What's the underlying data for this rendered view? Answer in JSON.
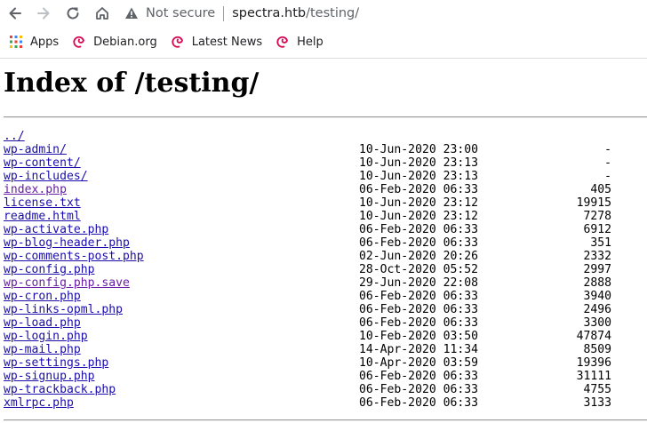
{
  "browser": {
    "address": {
      "security_label": "Not secure",
      "host": "spectra.htb",
      "path": "/testing/"
    },
    "bookmarks": [
      {
        "label": "Apps",
        "icon": "apps-grid-icon"
      },
      {
        "label": "Debian.org",
        "icon": "debian-swirl-icon"
      },
      {
        "label": "Latest News",
        "icon": "debian-swirl-icon"
      },
      {
        "label": "Help",
        "icon": "debian-swirl-icon"
      }
    ]
  },
  "page": {
    "title": "Index of /testing/",
    "entries": [
      {
        "name": "../",
        "date": "",
        "size": "",
        "visited": false
      },
      {
        "name": "wp-admin/",
        "date": "10-Jun-2020 23:00",
        "size": "-",
        "visited": false
      },
      {
        "name": "wp-content/",
        "date": "10-Jun-2020 23:13",
        "size": "-",
        "visited": false
      },
      {
        "name": "wp-includes/",
        "date": "10-Jun-2020 23:13",
        "size": "-",
        "visited": false
      },
      {
        "name": "index.php",
        "date": "06-Feb-2020 06:33",
        "size": "405",
        "visited": true
      },
      {
        "name": "license.txt",
        "date": "10-Jun-2020 23:12",
        "size": "19915",
        "visited": false
      },
      {
        "name": "readme.html",
        "date": "10-Jun-2020 23:12",
        "size": "7278",
        "visited": false
      },
      {
        "name": "wp-activate.php",
        "date": "06-Feb-2020 06:33",
        "size": "6912",
        "visited": false
      },
      {
        "name": "wp-blog-header.php",
        "date": "06-Feb-2020 06:33",
        "size": "351",
        "visited": false
      },
      {
        "name": "wp-comments-post.php",
        "date": "02-Jun-2020 20:26",
        "size": "2332",
        "visited": false
      },
      {
        "name": "wp-config.php",
        "date": "28-Oct-2020 05:52",
        "size": "2997",
        "visited": false
      },
      {
        "name": "wp-config.php.save",
        "date": "29-Jun-2020 22:08",
        "size": "2888",
        "visited": true
      },
      {
        "name": "wp-cron.php",
        "date": "06-Feb-2020 06:33",
        "size": "3940",
        "visited": false
      },
      {
        "name": "wp-links-opml.php",
        "date": "06-Feb-2020 06:33",
        "size": "2496",
        "visited": false
      },
      {
        "name": "wp-load.php",
        "date": "06-Feb-2020 06:33",
        "size": "3300",
        "visited": false
      },
      {
        "name": "wp-login.php",
        "date": "10-Feb-2020 03:50",
        "size": "47874",
        "visited": false
      },
      {
        "name": "wp-mail.php",
        "date": "14-Apr-2020 11:34",
        "size": "8509",
        "visited": false
      },
      {
        "name": "wp-settings.php",
        "date": "10-Apr-2020 03:59",
        "size": "19396",
        "visited": false
      },
      {
        "name": "wp-signup.php",
        "date": "06-Feb-2020 06:33",
        "size": "31111",
        "visited": false
      },
      {
        "name": "wp-trackback.php",
        "date": "06-Feb-2020 06:33",
        "size": "4755",
        "visited": false
      },
      {
        "name": "xmlrpc.php",
        "date": "06-Feb-2020 06:33",
        "size": "3133",
        "visited": false
      }
    ]
  }
}
